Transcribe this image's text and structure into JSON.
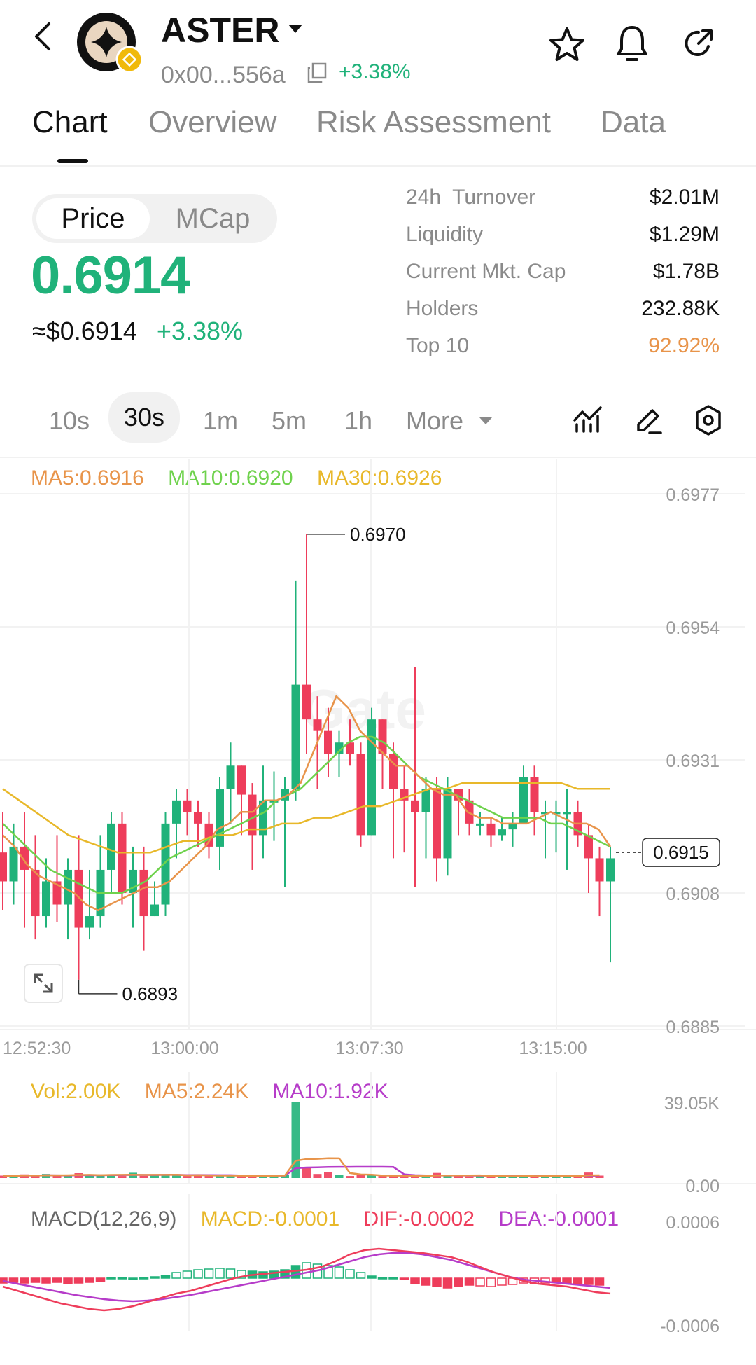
{
  "header": {
    "token_name": "ASTER",
    "address": "0x00...556a",
    "change": "+3.38%"
  },
  "tabs": [
    {
      "label": "Chart",
      "active": true
    },
    {
      "label": "Overview"
    },
    {
      "label": "Risk Assessment"
    },
    {
      "label": "Data"
    }
  ],
  "price_toggle": {
    "price": "Price",
    "mcap": "MCap",
    "selected": "Price"
  },
  "price": {
    "value": "0.6914",
    "usd": "≈$0.6914",
    "change": "+3.38%"
  },
  "stats": [
    {
      "label": "24h  Turnover",
      "value": "$2.01M"
    },
    {
      "label": "Liquidity",
      "value": "$1.29M"
    },
    {
      "label": "Current Mkt. Cap",
      "value": "$1.78B"
    },
    {
      "label": "Holders",
      "value": "232.88K"
    },
    {
      "label": "Top 10",
      "value": "92.92%",
      "color": "#e8944a"
    }
  ],
  "timeframes": [
    {
      "label": "10s"
    },
    {
      "label": "30s",
      "active": true
    },
    {
      "label": "1m"
    },
    {
      "label": "5m"
    },
    {
      "label": "1h"
    },
    {
      "label": "More"
    }
  ],
  "icons": {
    "back": "chevron-left-icon",
    "chain_badge": "bnb-badge-icon",
    "dropdown": "caret-down-icon",
    "copy": "copy-icon",
    "star": "star-icon",
    "bell": "bell-icon",
    "share": "share-icon",
    "indicator": "indicator-icon",
    "draw": "pen-icon",
    "settings": "hexagon-settings-icon",
    "expand": "expand-icon"
  },
  "colors": {
    "up": "#20b27a",
    "down": "#ee3d5b",
    "ma5": "#e8944a",
    "ma10": "#6fd24d",
    "ma30": "#e8b82a",
    "vol": "#e8b82a",
    "vol_ma10": "#b63cc9",
    "dea": "#b63cc9",
    "accent_orange": "#e8944a"
  },
  "chart_data": [
    {
      "type": "candlestick",
      "legend": [
        {
          "label": "MA5:0.6916",
          "color": "#e8944a"
        },
        {
          "label": "MA10:0.6920",
          "color": "#6fd24d"
        },
        {
          "label": "MA30:0.6926",
          "color": "#e8b82a"
        }
      ],
      "y_ticks": [
        "0.6977",
        "0.6954",
        "0.6931",
        "0.6908",
        "0.6885"
      ],
      "ylim": [
        0.6885,
        0.6977
      ],
      "x_ticks": [
        "12:52:30",
        "13:00:00",
        "13:07:30",
        "13:15:00"
      ],
      "max_label": "0.6970",
      "min_label": "0.6893",
      "current_price_label": "0.6915",
      "watermark": "Gate",
      "candles": [
        [
          0.6915,
          0.691,
          0.6922,
          0.6905
        ],
        [
          0.691,
          0.6916,
          0.692,
          0.6906
        ],
        [
          0.6916,
          0.6912,
          0.6922,
          0.6902
        ],
        [
          0.6912,
          0.6904,
          0.6918,
          0.69
        ],
        [
          0.6904,
          0.691,
          0.6914,
          0.6902
        ],
        [
          0.691,
          0.6906,
          0.6918,
          0.6903
        ],
        [
          0.6906,
          0.6912,
          0.6914,
          0.69
        ],
        [
          0.6912,
          0.6902,
          0.6918,
          0.6893
        ],
        [
          0.6902,
          0.6904,
          0.6912,
          0.69
        ],
        [
          0.6904,
          0.6912,
          0.6918,
          0.6902
        ],
        [
          0.6912,
          0.692,
          0.6922,
          0.6908
        ],
        [
          0.692,
          0.6908,
          0.6922,
          0.6906
        ],
        [
          0.6908,
          0.6912,
          0.6916,
          0.6902
        ],
        [
          0.6912,
          0.6904,
          0.6916,
          0.6898
        ],
        [
          0.6904,
          0.6906,
          0.691,
          0.6904
        ],
        [
          0.6906,
          0.692,
          0.6922,
          0.6904
        ],
        [
          0.692,
          0.6924,
          0.6926,
          0.6914
        ],
        [
          0.6924,
          0.6922,
          0.6926,
          0.6918
        ],
        [
          0.6922,
          0.692,
          0.6924,
          0.6916
        ],
        [
          0.692,
          0.6916,
          0.6922,
          0.6914
        ],
        [
          0.6916,
          0.6926,
          0.6928,
          0.6912
        ],
        [
          0.6926,
          0.693,
          0.6934,
          0.692
        ],
        [
          0.693,
          0.6925,
          0.693,
          0.6918
        ],
        [
          0.6925,
          0.6918,
          0.6927,
          0.6912
        ],
        [
          0.6918,
          0.6924,
          0.693,
          0.6914
        ],
        [
          0.6924,
          0.6924,
          0.6929,
          0.6917
        ],
        [
          0.6924,
          0.6926,
          0.6928,
          0.6909
        ],
        [
          0.6926,
          0.6944,
          0.6962,
          0.6924
        ],
        [
          0.6944,
          0.6938,
          0.697,
          0.6932
        ],
        [
          0.6938,
          0.6936,
          0.6942,
          0.6926
        ],
        [
          0.6936,
          0.6932,
          0.694,
          0.6928
        ],
        [
          0.6932,
          0.6934,
          0.6936,
          0.6928
        ],
        [
          0.6934,
          0.6932,
          0.6938,
          0.693
        ],
        [
          0.6932,
          0.6918,
          0.6934,
          0.6916
        ],
        [
          0.6918,
          0.6938,
          0.694,
          0.6918
        ],
        [
          0.6938,
          0.6932,
          0.6938,
          0.6926
        ],
        [
          0.6932,
          0.6926,
          0.6934,
          0.6914
        ],
        [
          0.6926,
          0.6924,
          0.693,
          0.6915
        ],
        [
          0.6924,
          0.6922,
          0.6947,
          0.6909
        ],
        [
          0.6922,
          0.6926,
          0.6928,
          0.6914
        ],
        [
          0.6926,
          0.6914,
          0.6928,
          0.691
        ],
        [
          0.6914,
          0.6926,
          0.6928,
          0.6911
        ],
        [
          0.6926,
          0.6924,
          0.6926,
          0.6918
        ],
        [
          0.6924,
          0.692,
          0.6926,
          0.6918
        ],
        [
          0.692,
          0.692,
          0.6922,
          0.6918
        ],
        [
          0.692,
          0.6918,
          0.6921,
          0.6916
        ],
        [
          0.6918,
          0.6919,
          0.6921,
          0.6917
        ],
        [
          0.6919,
          0.692,
          0.6922,
          0.6916
        ],
        [
          0.692,
          0.6928,
          0.693,
          0.692
        ],
        [
          0.6928,
          0.6922,
          0.693,
          0.6918
        ],
        [
          0.6922,
          0.6922,
          0.6924,
          0.6914
        ],
        [
          0.6922,
          0.6922,
          0.6924,
          0.6915
        ],
        [
          0.6922,
          0.6922,
          0.6926,
          0.6912
        ],
        [
          0.6922,
          0.6918,
          0.6924,
          0.6916
        ],
        [
          0.6918,
          0.6914,
          0.692,
          0.6908
        ],
        [
          0.6914,
          0.691,
          0.6916,
          0.6904
        ],
        [
          0.691,
          0.6914,
          0.6916,
          0.6896
        ]
      ],
      "ma5": [
        0.6918,
        0.6916,
        0.6913,
        0.6911,
        0.691,
        0.6909,
        0.6908,
        0.6906,
        0.6905,
        0.6906,
        0.6907,
        0.6908,
        0.6909,
        0.6909,
        0.691,
        0.6912,
        0.6914,
        0.6916,
        0.6919,
        0.692,
        0.6922,
        0.6922,
        0.6924,
        0.6924,
        0.6925,
        0.6927,
        0.6932,
        0.6937,
        0.6942,
        0.694,
        0.6936,
        0.6934,
        0.6932,
        0.693,
        0.693,
        0.6928,
        0.6926,
        0.6925,
        0.6925,
        0.6922,
        0.6921,
        0.6921,
        0.692,
        0.692,
        0.692,
        0.6921,
        0.6922,
        0.6921,
        0.692,
        0.692,
        0.6919,
        0.6916
      ],
      "ma10": [
        0.692,
        0.6918,
        0.6916,
        0.6914,
        0.6912,
        0.6911,
        0.691,
        0.6909,
        0.6908,
        0.6908,
        0.6908,
        0.6909,
        0.691,
        0.6912,
        0.6914,
        0.6915,
        0.6916,
        0.6917,
        0.6918,
        0.6919,
        0.692,
        0.6921,
        0.6922,
        0.6924,
        0.6925,
        0.6926,
        0.6928,
        0.693,
        0.6932,
        0.6934,
        0.6935,
        0.6935,
        0.6934,
        0.6932,
        0.693,
        0.6928,
        0.6927,
        0.6926,
        0.6925,
        0.6924,
        0.6923,
        0.6922,
        0.6921,
        0.6921,
        0.6921,
        0.6921,
        0.692,
        0.692,
        0.6919,
        0.6918,
        0.6917,
        0.6916
      ],
      "ma30": [
        0.6926,
        0.6924,
        0.6922,
        0.692,
        0.6918,
        0.6917,
        0.6916,
        0.6915,
        0.6915,
        0.6915,
        0.6916,
        0.6917,
        0.6917,
        0.6918,
        0.6918,
        0.6919,
        0.6919,
        0.692,
        0.692,
        0.6921,
        0.6921,
        0.6922,
        0.6923,
        0.6923,
        0.6924,
        0.6925,
        0.6926,
        0.6926,
        0.6927,
        0.6927,
        0.6927,
        0.6927,
        0.6927,
        0.6927,
        0.6927,
        0.6926,
        0.6926,
        0.6926
      ]
    },
    {
      "type": "bar",
      "legend": [
        {
          "label": "Vol:2.00K",
          "color": "#e8b82a"
        },
        {
          "label": "MA5:2.24K",
          "color": "#e8944a"
        },
        {
          "label": "MA10:1.92K",
          "color": "#b63cc9"
        }
      ],
      "y_ticks": [
        "39.05K",
        "0.00"
      ],
      "ylim": [
        0,
        39.05
      ],
      "values": [
        1.2,
        0.8,
        1.8,
        1.0,
        2.0,
        1.1,
        0.9,
        2.4,
        1.5,
        1.2,
        1.8,
        1.0,
        2.6,
        1.1,
        1.4,
        1.8,
        1.3,
        1.0,
        1.6,
        1.0,
        1.2,
        1.1,
        0.9,
        1.0,
        1.4,
        1.2,
        1.6,
        37.0,
        5.0,
        2.0,
        2.8,
        1.4,
        1.0,
        1.5,
        1.4,
        1.0,
        0.9,
        1.2,
        0.8,
        1.0,
        2.5,
        1.0,
        1.2,
        0.8,
        1.1,
        0.9,
        0.7,
        1.1,
        1.0,
        0.9,
        1.0,
        1.1,
        0.8,
        1.0,
        2.7,
        1.2
      ]
    },
    {
      "type": "bar",
      "subtype": "macd",
      "legend": [
        {
          "label": "MACD(12,26,9)",
          "color": "#666666"
        },
        {
          "label": "MACD:-0.0001",
          "color": "#e8b82a"
        },
        {
          "label": "DIF:-0.0002",
          "color": "#ee3d5b"
        },
        {
          "label": "DEA:-0.0001",
          "color": "#b63cc9"
        }
      ],
      "y_ticks": [
        "0.0006",
        "-0.0006"
      ],
      "ylim": [
        -0.0006,
        0.0006
      ],
      "hist": [
        -7e-05,
        -6e-05,
        -7e-05,
        -6e-05,
        -7e-05,
        -6e-05,
        -8e-05,
        -7e-05,
        -6e-05,
        -5e-05,
        1e-05,
        1e-05,
        0.0,
        1e-05,
        2e-05,
        4e-05,
        8e-05,
        0.0001,
        0.00012,
        0.00013,
        0.00014,
        0.00013,
        0.00011,
        0.0001,
        9e-05,
        0.0001,
        0.00012,
        0.00018,
        0.00022,
        0.0002,
        0.00018,
        0.00016,
        0.00012,
        8e-05,
        3e-05,
        1e-05,
        1e-05,
        -2e-05,
        -8e-05,
        -0.0001,
        -0.00012,
        -0.00014,
        -0.00012,
        -0.0001,
        -0.00011,
        -0.00012,
        -0.0001,
        -9e-05,
        -7e-05,
        -8e-05,
        -7e-05,
        -6e-05,
        -7e-05,
        -8e-05,
        -9e-05,
        -0.0001
      ],
      "dif": [
        -0.00012,
        -0.00018,
        -0.00024,
        -0.0003,
        -0.00036,
        -0.0004,
        -0.00044,
        -0.00046,
        -0.00044,
        -0.0004,
        -0.00034,
        -0.00028,
        -0.00022,
        -0.00018,
        -0.00012,
        -6e-05,
        0.0,
        4e-05,
        6e-05,
        8e-05,
        0.0001,
        0.00012,
        0.00016,
        0.00024,
        0.00034,
        0.0004,
        0.00042,
        0.0004,
        0.00038,
        0.00036,
        0.00033,
        0.0003,
        0.00024,
        0.00016,
        8e-05,
        2e-05,
        -4e-05,
        -8e-05,
        -0.0001,
        -0.00012,
        -0.00016,
        -0.0002,
        -0.00022
      ],
      "dea": [
        -4e-05,
        -8e-05,
        -0.00012,
        -0.00016,
        -0.0002,
        -0.00024,
        -0.00027,
        -0.0003,
        -0.00032,
        -0.00033,
        -0.00032,
        -0.0003,
        -0.00027,
        -0.00024,
        -0.0002,
        -0.00016,
        -0.00012,
        -8e-05,
        -4e-05,
        0.0,
        4e-05,
        8e-05,
        0.00012,
        0.00018,
        0.00024,
        0.0003,
        0.00034,
        0.00036,
        0.00036,
        0.00034,
        0.0003,
        0.00026,
        0.0002,
        0.00014,
        8e-05,
        2e-05,
        -2e-05,
        -4e-05,
        -6e-05,
        -8e-05,
        -0.0001,
        -0.00012,
        -0.00014
      ]
    }
  ]
}
